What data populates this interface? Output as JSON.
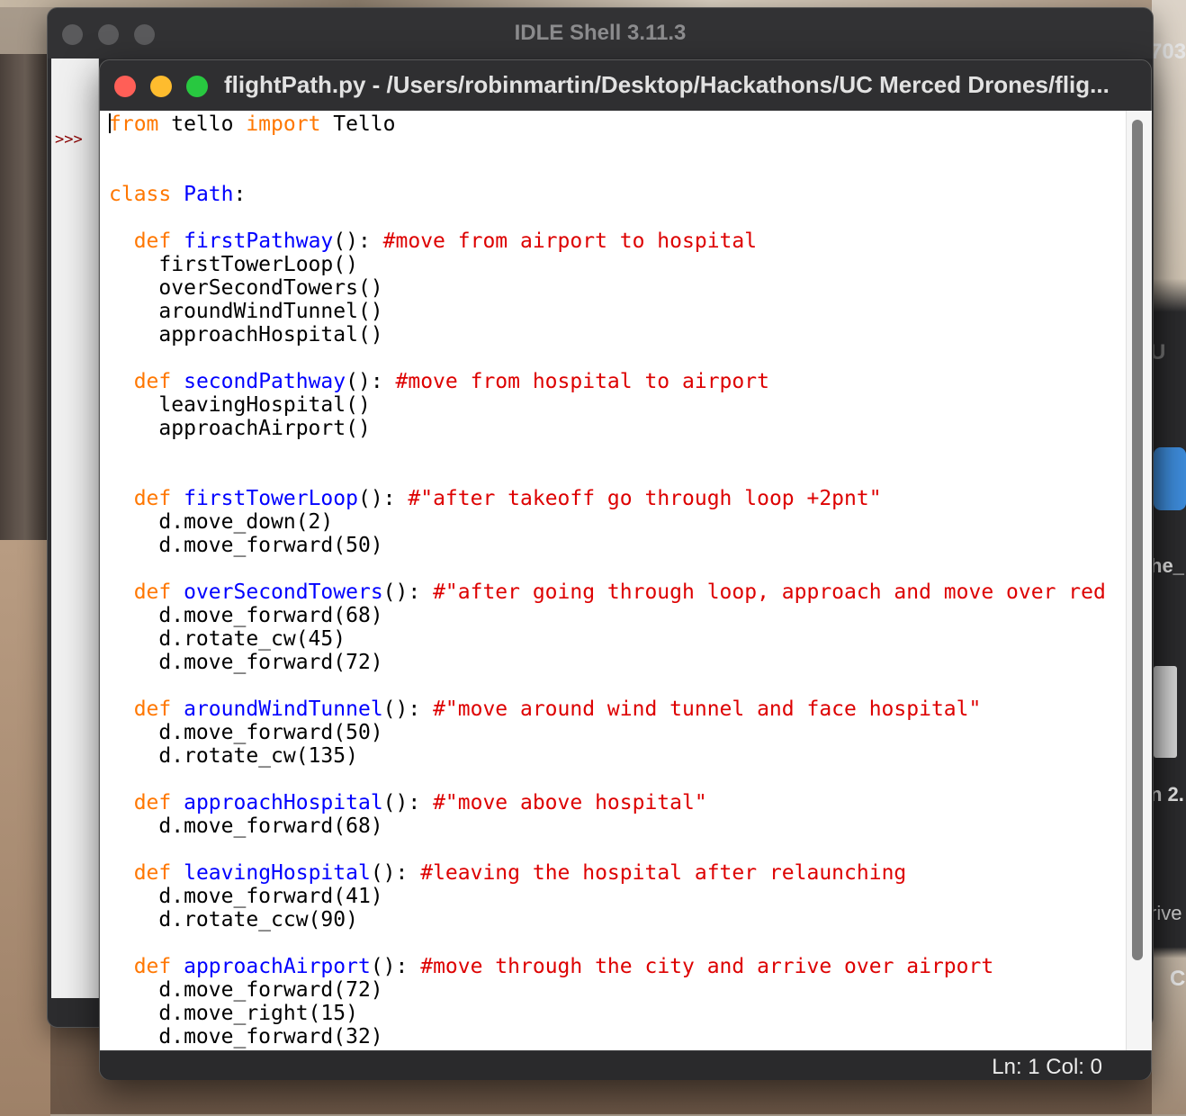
{
  "shell_window": {
    "title": "IDLE Shell 3.11.3",
    "prompt": ">>>"
  },
  "editor_window": {
    "title": "flightPath.py - /Users/robinmartin/Desktop/Hackathons/UC Merced Drones/flig..."
  },
  "code": [
    [
      [
        "kw",
        "from"
      ],
      [
        "n",
        " tello "
      ],
      [
        "kw",
        "import"
      ],
      [
        "n",
        " Tello"
      ]
    ],
    [],
    [],
    [
      [
        "kw",
        "class"
      ],
      [
        "n",
        " "
      ],
      [
        "def",
        "Path"
      ],
      [
        "n",
        ":"
      ]
    ],
    [],
    [
      [
        "n",
        "  "
      ],
      [
        "kw",
        "def"
      ],
      [
        "n",
        " "
      ],
      [
        "def",
        "firstPathway"
      ],
      [
        "n",
        "(): "
      ],
      [
        "cm",
        "#move from airport to hospital"
      ]
    ],
    [
      [
        "n",
        "    firstTowerLoop()"
      ]
    ],
    [
      [
        "n",
        "    overSecondTowers()"
      ]
    ],
    [
      [
        "n",
        "    aroundWindTunnel()"
      ]
    ],
    [
      [
        "n",
        "    approachHospital()"
      ]
    ],
    [],
    [
      [
        "n",
        "  "
      ],
      [
        "kw",
        "def"
      ],
      [
        "n",
        " "
      ],
      [
        "def",
        "secondPathway"
      ],
      [
        "n",
        "(): "
      ],
      [
        "cm",
        "#move from hospital to airport"
      ]
    ],
    [
      [
        "n",
        "    leavingHospital()"
      ]
    ],
    [
      [
        "n",
        "    approachAirport()"
      ]
    ],
    [],
    [],
    [
      [
        "n",
        "  "
      ],
      [
        "kw",
        "def"
      ],
      [
        "n",
        " "
      ],
      [
        "def",
        "firstTowerLoop"
      ],
      [
        "n",
        "(): "
      ],
      [
        "cm",
        "#\"after takeoff go through loop +2pnt\""
      ]
    ],
    [
      [
        "n",
        "    d.move_down(2)"
      ]
    ],
    [
      [
        "n",
        "    d.move_forward(50)"
      ]
    ],
    [],
    [
      [
        "n",
        "  "
      ],
      [
        "kw",
        "def"
      ],
      [
        "n",
        " "
      ],
      [
        "def",
        "overSecondTowers"
      ],
      [
        "n",
        "(): "
      ],
      [
        "cm",
        "#\"after going through loop, approach and move over red"
      ]
    ],
    [
      [
        "n",
        "    d.move_forward(68)"
      ]
    ],
    [
      [
        "n",
        "    d.rotate_cw(45)"
      ]
    ],
    [
      [
        "n",
        "    d.move_forward(72)"
      ]
    ],
    [],
    [
      [
        "n",
        "  "
      ],
      [
        "kw",
        "def"
      ],
      [
        "n",
        " "
      ],
      [
        "def",
        "aroundWindTunnel"
      ],
      [
        "n",
        "(): "
      ],
      [
        "cm",
        "#\"move around wind tunnel and face hospital\""
      ]
    ],
    [
      [
        "n",
        "    d.move_forward(50)"
      ]
    ],
    [
      [
        "n",
        "    d.rotate_cw(135)"
      ]
    ],
    [],
    [
      [
        "n",
        "  "
      ],
      [
        "kw",
        "def"
      ],
      [
        "n",
        " "
      ],
      [
        "def",
        "approachHospital"
      ],
      [
        "n",
        "(): "
      ],
      [
        "cm",
        "#\"move above hospital\""
      ]
    ],
    [
      [
        "n",
        "    d.move_forward(68)"
      ]
    ],
    [],
    [
      [
        "n",
        "  "
      ],
      [
        "kw",
        "def"
      ],
      [
        "n",
        " "
      ],
      [
        "def",
        "leavingHospital"
      ],
      [
        "n",
        "(): "
      ],
      [
        "cm",
        "#leaving the hospital after relaunching"
      ]
    ],
    [
      [
        "n",
        "    d.move_forward(41)"
      ]
    ],
    [
      [
        "n",
        "    d.rotate_ccw(90)"
      ]
    ],
    [],
    [
      [
        "n",
        "  "
      ],
      [
        "kw",
        "def"
      ],
      [
        "n",
        " "
      ],
      [
        "def",
        "approachAirport"
      ],
      [
        "n",
        "(): "
      ],
      [
        "cm",
        "#move through the city and arrive over airport"
      ]
    ],
    [
      [
        "n",
        "    d.move_forward(72)"
      ]
    ],
    [
      [
        "n",
        "    d.move_right(15)"
      ]
    ],
    [
      [
        "n",
        "    d.move_forward(32)"
      ]
    ]
  ],
  "status": {
    "position": "Ln: 1  Col: 0"
  },
  "background_fragments": {
    "top_right": "703",
    "right_1": "he_",
    "right_2": "n 2.",
    "right_3": "rive",
    "right_4": "C",
    "right_5": "U"
  },
  "colors": {
    "keyword": "#ff7700",
    "definition": "#0000ff",
    "comment": "#dd0000",
    "text": "#000000"
  }
}
